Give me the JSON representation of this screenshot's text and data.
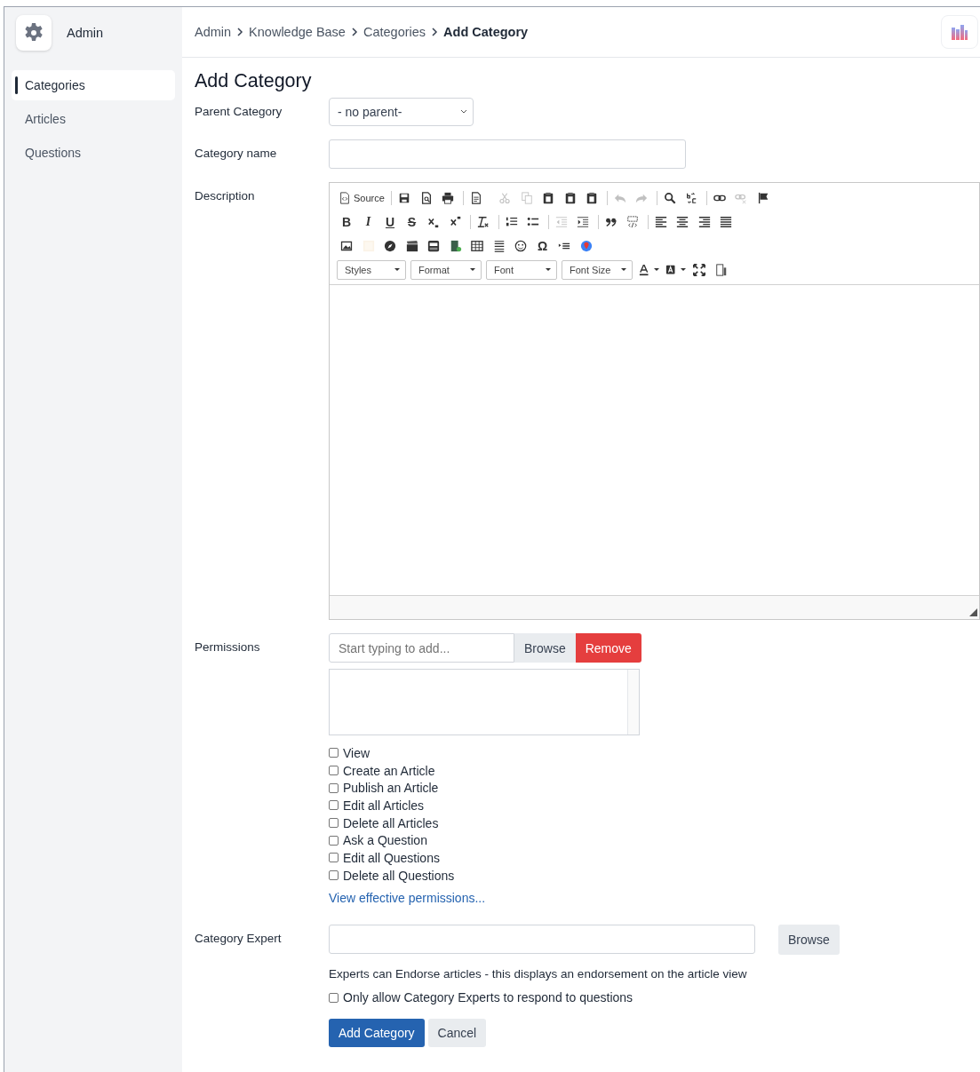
{
  "sidebar": {
    "title": "Admin",
    "items": [
      {
        "label": "Categories",
        "selected": true
      },
      {
        "label": "Articles",
        "selected": false
      },
      {
        "label": "Questions",
        "selected": false
      }
    ]
  },
  "breadcrumb": {
    "links": [
      "Admin",
      "Knowledge Base",
      "Categories"
    ],
    "current": "Add Category"
  },
  "page_title": "Add Category",
  "parent_category": {
    "label": "Parent Category",
    "value": "- no parent-"
  },
  "category_name": {
    "label": "Category name"
  },
  "description": {
    "label": "Description",
    "toolbar": [
      [
        [
          {
            "label": "Source",
            "disabled": false
          }
        ],
        [
          {
            "disabled": false
          },
          {
            "disabled": false
          },
          {
            "disabled": false
          }
        ],
        [
          {
            "disabled": false
          }
        ],
        [
          {
            "disabled": true
          },
          {
            "disabled": true
          },
          {
            "disabled": false
          },
          {
            "disabled": false
          },
          {
            "disabled": false
          }
        ],
        [
          {
            "disabled": true
          },
          {
            "disabled": true
          }
        ],
        [
          {
            "disabled": false
          },
          {
            "disabled": false
          }
        ],
        [
          {
            "disabled": false
          },
          {
            "disabled": true
          },
          {
            "disabled": false
          }
        ]
      ],
      [
        [
          {
            "label": "B",
            "disabled": false
          },
          {
            "label": "I",
            "disabled": false
          },
          {
            "label": "U",
            "disabled": false
          },
          {
            "label": "S",
            "disabled": false
          },
          {
            "disabled": false
          },
          {
            "disabled": false
          }
        ],
        [
          {
            "disabled": false
          }
        ],
        [
          {
            "disabled": false
          },
          {
            "disabled": false
          }
        ],
        [
          {
            "disabled": true
          },
          {
            "disabled": false
          }
        ],
        [
          {
            "disabled": false
          },
          {
            "disabled": false
          }
        ],
        [
          {
            "disabled": false
          },
          {
            "disabled": false
          },
          {
            "disabled": false
          },
          {
            "disabled": false
          }
        ]
      ],
      [
        [
          {
            "disabled": false
          },
          {
            "disabled": true
          },
          {
            "disabled": false
          },
          {
            "disabled": false
          },
          {
            "disabled": false
          },
          {
            "disabled": false
          },
          {
            "disabled": false
          },
          {
            "disabled": false
          },
          {
            "disabled": false
          },
          {
            "label": "Ω",
            "disabled": false
          },
          {
            "disabled": false
          },
          {
            "disabled": false
          }
        ]
      ]
    ],
    "combos": [
      "Styles",
      "Format",
      "Font",
      "Font Size"
    ]
  },
  "permissions": {
    "label": "Permissions",
    "placeholder": "Start typing to add...",
    "browse": "Browse",
    "remove": "Remove",
    "items": [
      {
        "label": "View",
        "checked": false
      },
      {
        "label": "Create an Article",
        "checked": false
      },
      {
        "label": "Publish an Article",
        "checked": false
      },
      {
        "label": "Edit all Articles",
        "checked": false
      },
      {
        "label": "Delete all Articles",
        "checked": false
      },
      {
        "label": "Ask a Question",
        "checked": false
      },
      {
        "label": "Edit all Questions",
        "checked": false
      },
      {
        "label": "Delete all Questions",
        "checked": false
      }
    ],
    "link": "View effective permissions..."
  },
  "category_expert": {
    "label": "Category Expert",
    "browse": "Browse",
    "help": "Experts can Endorse articles - this displays an endorsement on the article view",
    "only_experts": {
      "label": "Only allow Category Experts to respond to questions",
      "checked": false
    }
  },
  "buttons": {
    "submit": "Add Category",
    "cancel": "Cancel"
  }
}
